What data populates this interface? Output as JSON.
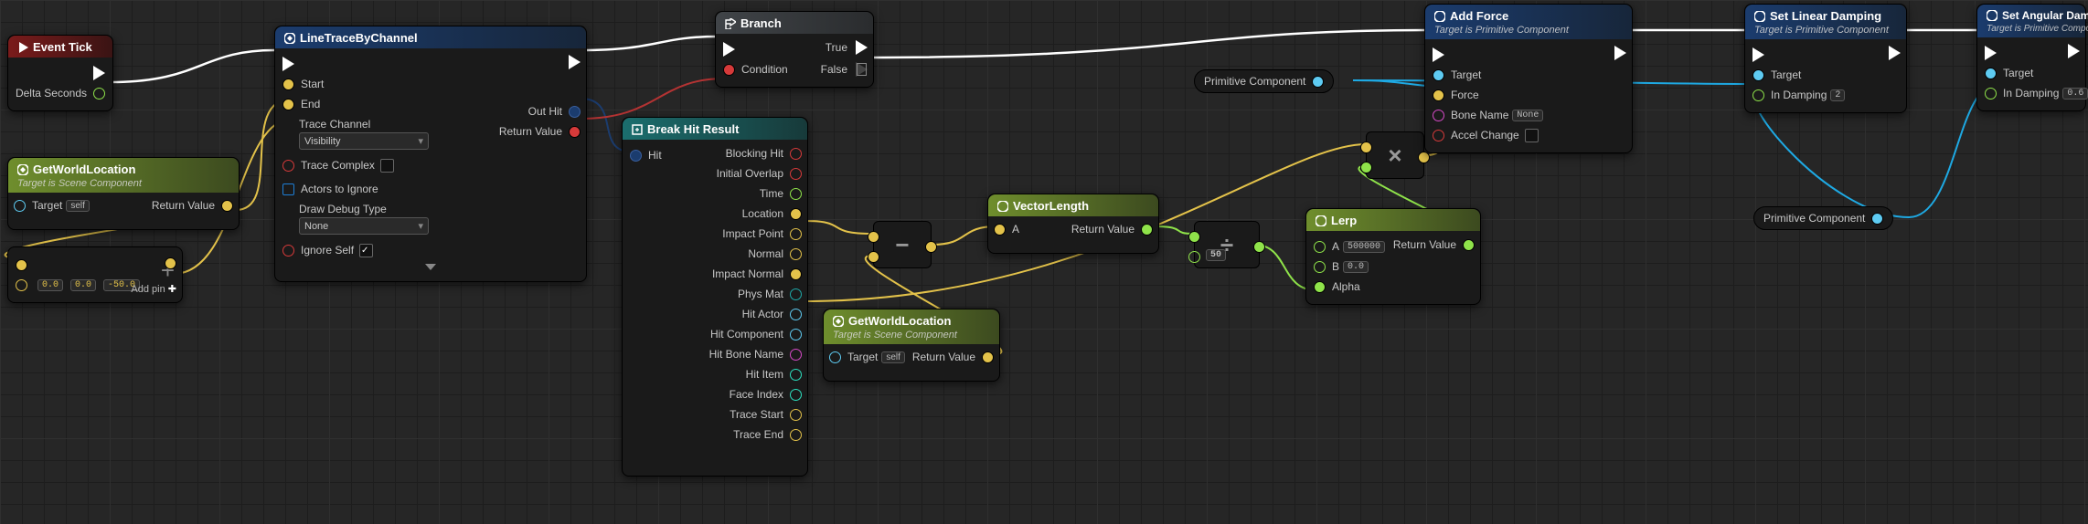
{
  "nodes": {
    "eventTick": {
      "title": "Event Tick",
      "pins": {
        "deltaSeconds": "Delta Seconds"
      }
    },
    "getWorldLocation1": {
      "title": "GetWorldLocation",
      "subtitle": "Target is Scene Component",
      "pins": {
        "target": "Target",
        "self": "self",
        "returnValue": "Return Value"
      }
    },
    "vectorAdd": {
      "pins": {
        "x": "0.0",
        "y": "0.0",
        "z": "-50.0",
        "addPin": "Add pin"
      }
    },
    "lineTrace": {
      "title": "LineTraceByChannel",
      "pins": {
        "start": "Start",
        "end": "End",
        "traceChannel": "Trace Channel",
        "visibility": "Visibility",
        "traceComplex": "Trace Complex",
        "actorsToIgnore": "Actors to Ignore",
        "drawDebugType": "Draw Debug Type",
        "none": "None",
        "ignoreSelf": "Ignore Self",
        "outHit": "Out Hit",
        "returnValue": "Return Value"
      }
    },
    "branch": {
      "title": "Branch",
      "pins": {
        "condition": "Condition",
        "true": "True",
        "false": "False"
      }
    },
    "breakHit": {
      "title": "Break Hit Result",
      "pins": {
        "hit": "Hit",
        "blockingHit": "Blocking Hit",
        "initialOverlap": "Initial Overlap",
        "time": "Time",
        "location": "Location",
        "impactPoint": "Impact Point",
        "normal": "Normal",
        "impactNormal": "Impact Normal",
        "physMat": "Phys Mat",
        "hitActor": "Hit Actor",
        "hitComponent": "Hit Component",
        "hitBoneName": "Hit Bone Name",
        "hitItem": "Hit Item",
        "faceIndex": "Face Index",
        "traceStart": "Trace Start",
        "traceEnd": "Trace End"
      }
    },
    "getWorldLocation2": {
      "title": "GetWorldLocation",
      "subtitle": "Target is Scene Component",
      "pins": {
        "target": "Target",
        "self": "self",
        "returnValue": "Return Value"
      }
    },
    "vectorLength": {
      "title": "VectorLength",
      "pins": {
        "a": "A",
        "returnValue": "Return Value"
      }
    },
    "divide": {
      "val": "50"
    },
    "lerp": {
      "title": "Lerp",
      "pins": {
        "a": "A",
        "aVal": "500000",
        "b": "B",
        "bVal": "0.0",
        "alpha": "Alpha",
        "returnValue": "Return Value"
      }
    },
    "multiply": {},
    "primComp1": {
      "label": "Primitive Component"
    },
    "primComp2": {
      "label": "Primitive Component"
    },
    "addForce": {
      "title": "Add Force",
      "subtitle": "Target is Primitive Component",
      "pins": {
        "target": "Target",
        "force": "Force",
        "boneName": "Bone Name",
        "none": "None",
        "accelChange": "Accel Change"
      }
    },
    "setLinearDamping": {
      "title": "Set Linear Damping",
      "subtitle": "Target is Primitive Component",
      "pins": {
        "target": "Target",
        "inDamping": "In Damping",
        "val": "2"
      }
    },
    "setAngularDamping": {
      "title": "Set Angular Damping",
      "subtitle": "Target is Primitive Component",
      "pins": {
        "target": "Target",
        "inDamping": "In Damping",
        "val": "0.6"
      }
    }
  }
}
